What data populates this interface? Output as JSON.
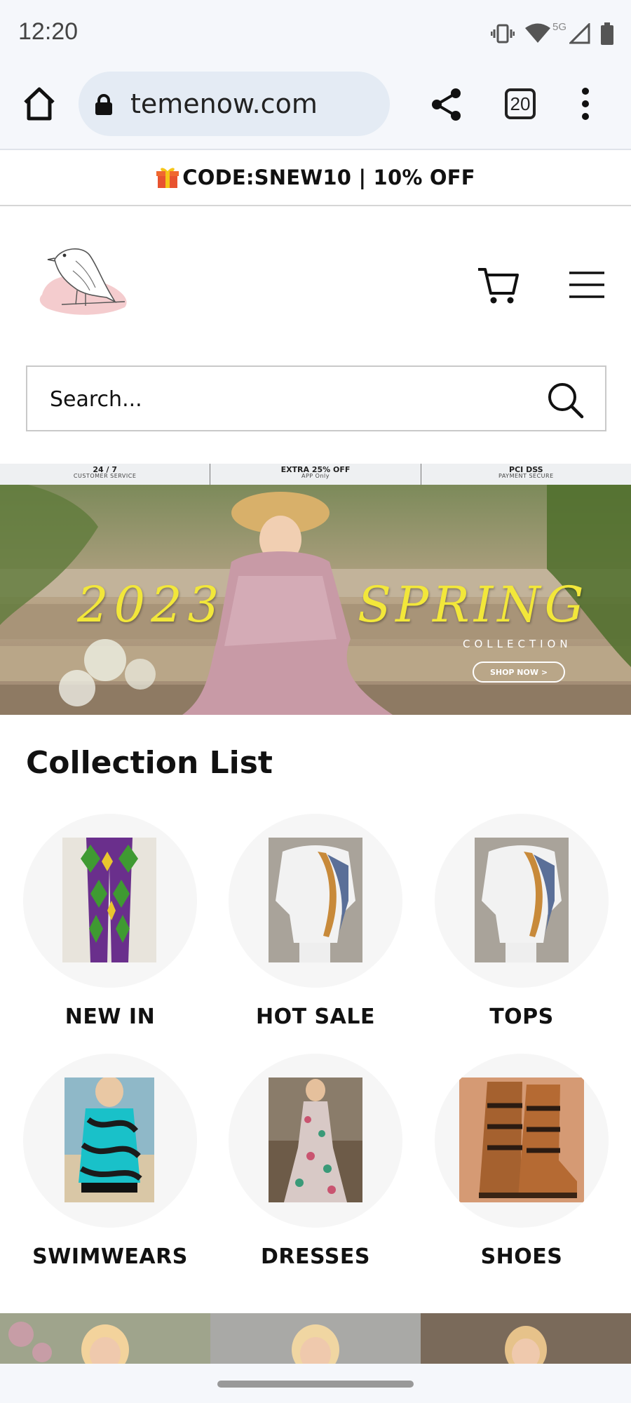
{
  "status_bar": {
    "time": "12:20",
    "network_label": "5G",
    "icons": [
      "vibrate-icon",
      "wifi-icon",
      "signal-icon",
      "battery-icon"
    ]
  },
  "browser": {
    "url": "temenow.com",
    "tab_count": "20",
    "icons": [
      "home-icon",
      "lock-icon",
      "share-icon",
      "tabs-icon",
      "more-vert-icon"
    ]
  },
  "promo": {
    "icon": "gift-icon",
    "text": "CODE:SNEW10 | 10% OFF"
  },
  "header": {
    "logo": "bird-logo",
    "icons": [
      "cart-icon",
      "hamburger-icon"
    ]
  },
  "search": {
    "placeholder": "Search...",
    "icon": "search-icon"
  },
  "banner": {
    "info": [
      {
        "title": "24 / 7",
        "subtitle": "CUSTOMER SERVICE"
      },
      {
        "title": "EXTRA 25% OFF",
        "subtitle": "APP Only"
      },
      {
        "title": "PCI DSS",
        "subtitle": "PAYMENT SECURE"
      }
    ],
    "year": "2023",
    "season": "SPRING",
    "collection": "COLLECTION",
    "cta": "SHOP NOW >"
  },
  "collection": {
    "title": "Collection List",
    "items": [
      {
        "label": "NEW IN"
      },
      {
        "label": "HOT SALE"
      },
      {
        "label": "TOPS"
      },
      {
        "label": "SWIMWEARS"
      },
      {
        "label": "DRESSES"
      },
      {
        "label": "SHOES"
      }
    ]
  },
  "colors": {
    "accent_yellow": "#f2e73a",
    "text": "#111111",
    "circle_bg": "#f6f6f6",
    "url_pill": "#e4ebf4"
  }
}
